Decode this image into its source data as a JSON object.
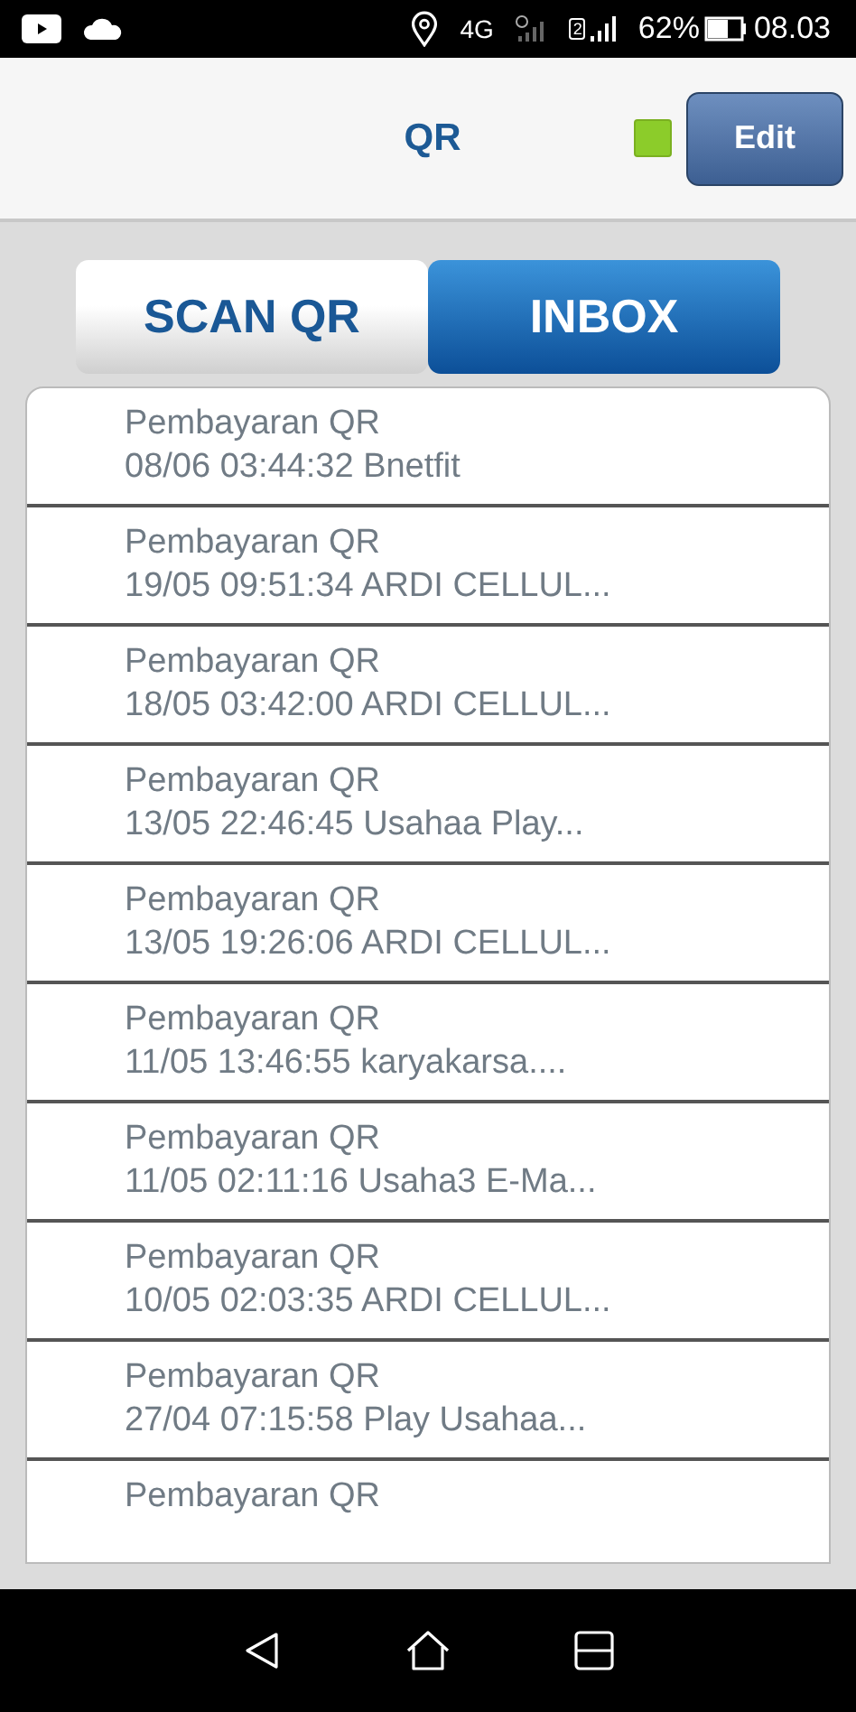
{
  "status_bar": {
    "network": "4G",
    "sim_badge": "2",
    "battery": "62%",
    "time": "08.03"
  },
  "header": {
    "title": "QR",
    "edit_button": "Edit"
  },
  "tabs": [
    {
      "label": "SCAN QR",
      "selected": false
    },
    {
      "label": "INBOX",
      "selected": true
    }
  ],
  "messages": [
    {
      "title": "Pembayaran QR",
      "detail": "08/06 03:44:32 Bnetfit"
    },
    {
      "title": "Pembayaran QR",
      "detail": "19/05 09:51:34 ARDI CELLUL..."
    },
    {
      "title": "Pembayaran QR",
      "detail": "18/05 03:42:00 ARDI CELLUL..."
    },
    {
      "title": "Pembayaran QR",
      "detail": "13/05 22:46:45 Usahaa Play..."
    },
    {
      "title": "Pembayaran QR",
      "detail": "13/05 19:26:06 ARDI CELLUL..."
    },
    {
      "title": "Pembayaran QR",
      "detail": "11/05 13:46:55 karyakarsa...."
    },
    {
      "title": "Pembayaran QR",
      "detail": "11/05 02:11:16 Usaha3 E-Ma..."
    },
    {
      "title": "Pembayaran QR",
      "detail": "10/05 02:03:35 ARDI CELLUL..."
    },
    {
      "title": "Pembayaran QR",
      "detail": "27/04 07:15:58 Play Usahaa..."
    },
    {
      "title": "Pembayaran QR"
    }
  ]
}
